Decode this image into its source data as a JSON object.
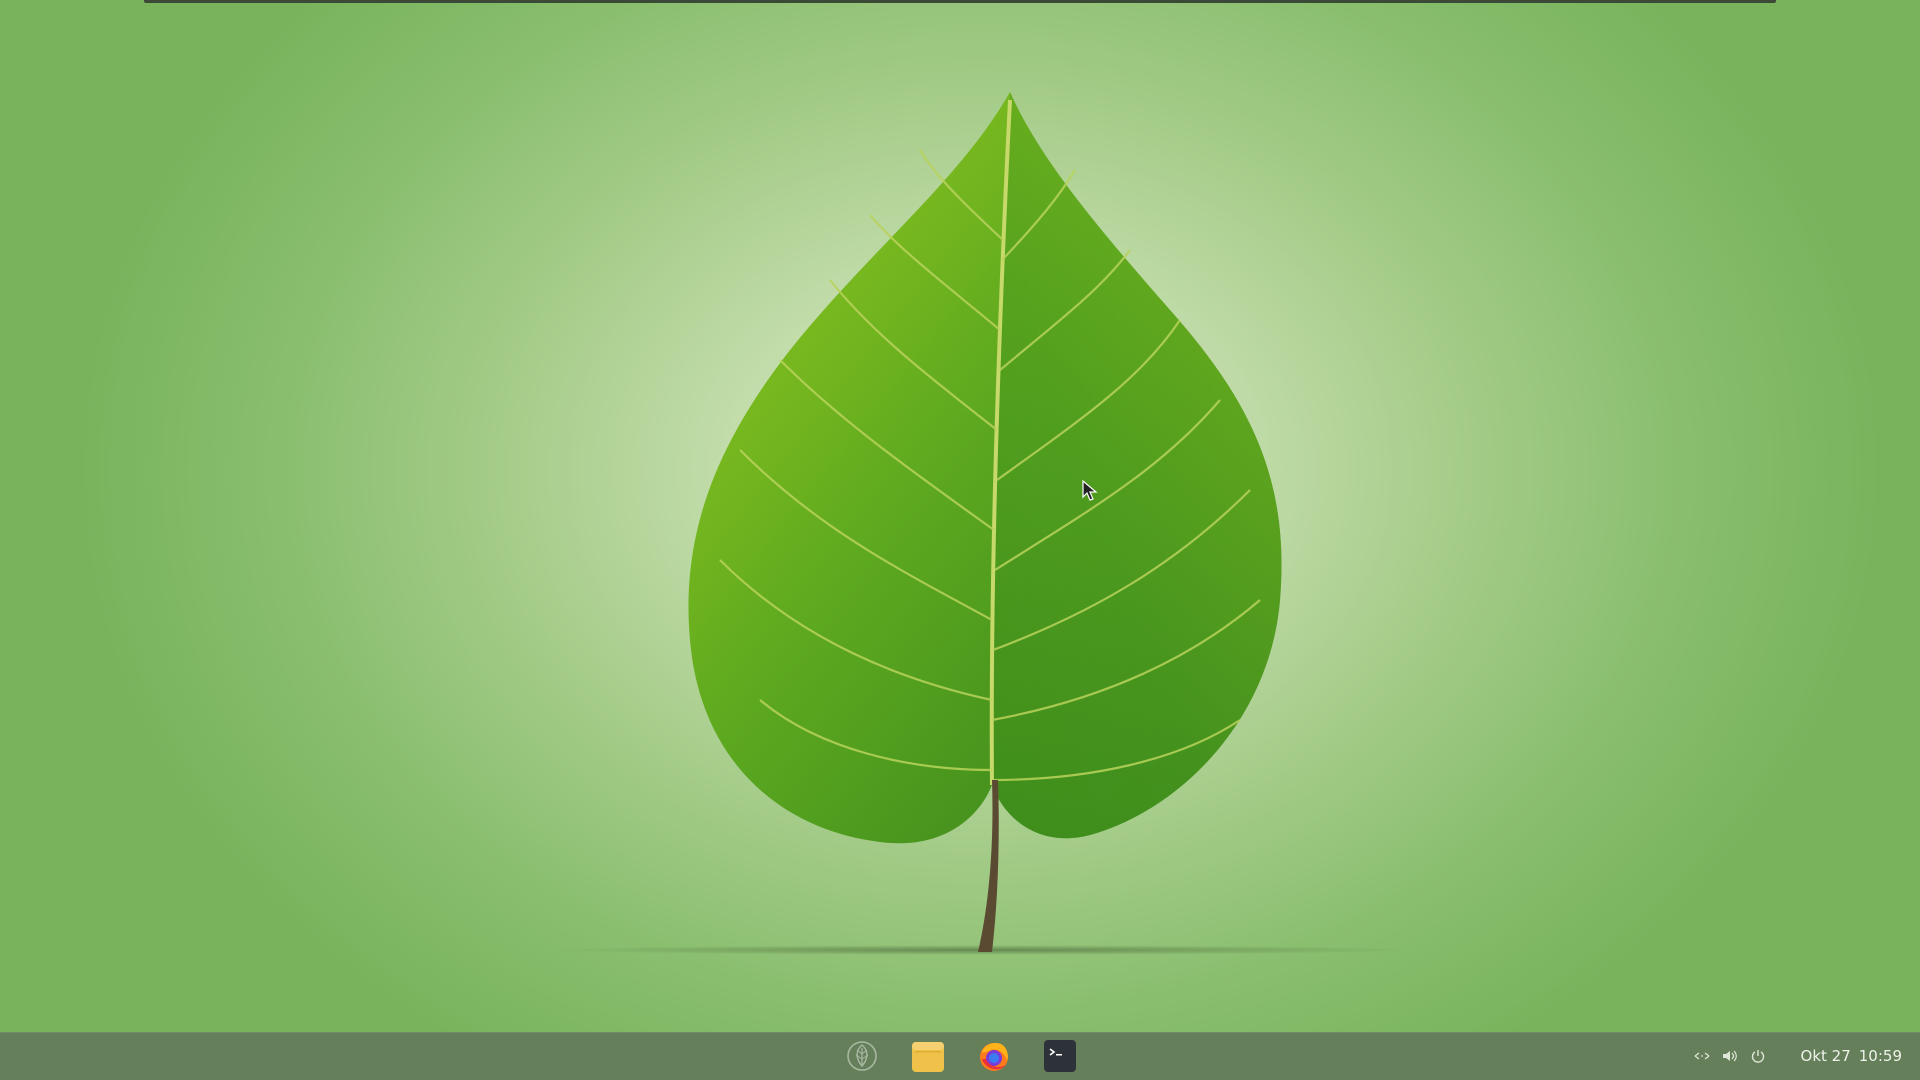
{
  "desktop": {
    "wallpaper": "green-leaf-wallpaper",
    "colors": {
      "background_center": "#e0ecd1",
      "background_edge": "#79b45d",
      "leaf_light": "#8cc31e",
      "leaf_dark": "#2f7d1d",
      "taskbar": "#667f5b"
    }
  },
  "dock": {
    "items": [
      {
        "name": "app-menu",
        "icon": "leaf-logo-icon"
      },
      {
        "name": "files",
        "icon": "folder-icon"
      },
      {
        "name": "firefox",
        "icon": "firefox-icon"
      },
      {
        "name": "terminal",
        "icon": "terminal-icon"
      }
    ]
  },
  "tray": {
    "icons": [
      "network-icon",
      "volume-icon",
      "power-icon"
    ],
    "date": "Okt 27",
    "time": "10:59"
  }
}
